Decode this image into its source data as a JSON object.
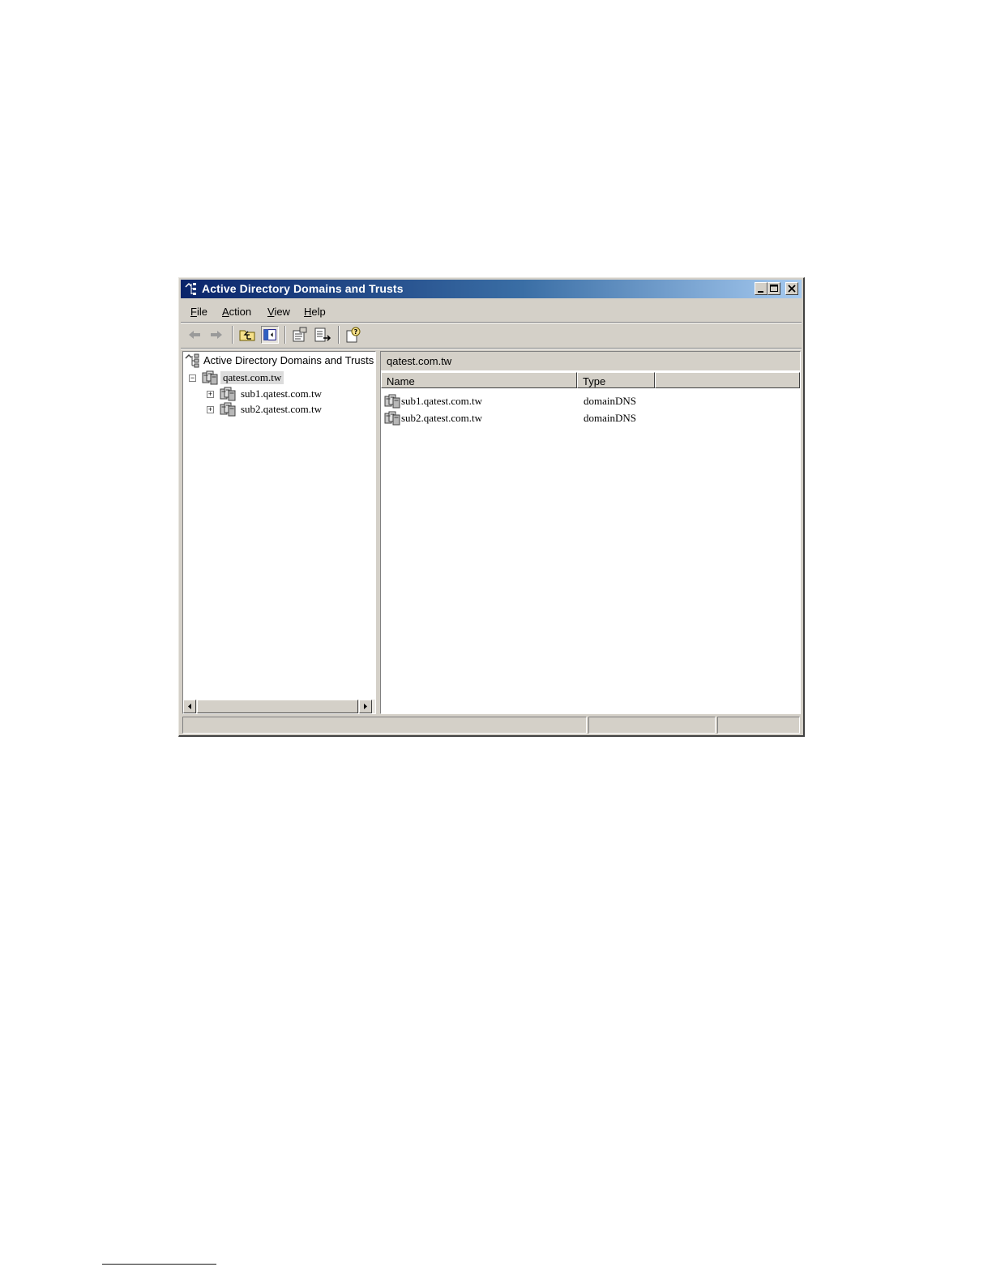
{
  "window": {
    "title": "Active Directory Domains and Trusts"
  },
  "menu": {
    "file": {
      "accel": "F",
      "rest": "ile"
    },
    "action": {
      "accel": "A",
      "rest": "ction"
    },
    "view": {
      "accel": "V",
      "rest": "iew"
    },
    "help": {
      "accel": "H",
      "rest": "elp"
    }
  },
  "toolbar": {
    "icons": [
      "back-arrow-icon",
      "forward-arrow-icon",
      "up-folder-icon",
      "show-hide-tree-icon",
      "properties-icon",
      "export-list-icon",
      "help-icon"
    ]
  },
  "tree": {
    "root": "Active Directory Domains and Trusts",
    "selected": "qatest.com.tw",
    "children": [
      "sub1.qatest.com.tw",
      "sub2.qatest.com.tw"
    ],
    "expanded_symbol": "−",
    "collapsed_symbol": "+"
  },
  "list": {
    "title": "qatest.com.tw",
    "columns": [
      "Name",
      "Type"
    ],
    "rows": [
      {
        "name": "sub1.qatest.com.tw",
        "type": "domainDNS"
      },
      {
        "name": "sub2.qatest.com.tw",
        "type": "domainDNS"
      }
    ]
  },
  "colors": {
    "title_start": "#0a246a",
    "title_end": "#a6caf0",
    "chrome": "#d4d0c8"
  }
}
